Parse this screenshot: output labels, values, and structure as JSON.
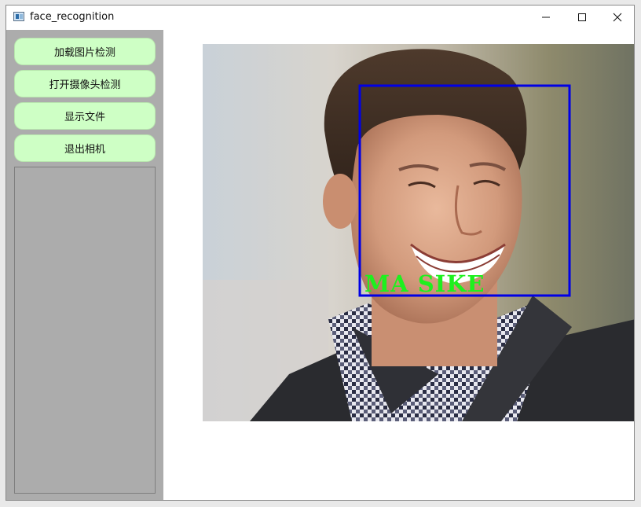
{
  "window": {
    "title": "face_recognition",
    "icon": "app-window-icon",
    "controls": [
      "minimize-icon",
      "maximize-icon",
      "close-icon"
    ]
  },
  "sidebar": {
    "background": "#acacac",
    "button_color": "#ceffc5",
    "buttons": [
      {
        "label": "加载图片检测"
      },
      {
        "label": "打开摄像头检测"
      },
      {
        "label": "显示文件"
      },
      {
        "label": "退出相机"
      }
    ]
  },
  "detection": {
    "box_color": "#0000e6",
    "label": "MA SIKE",
    "label_color": "#1ef01e"
  }
}
